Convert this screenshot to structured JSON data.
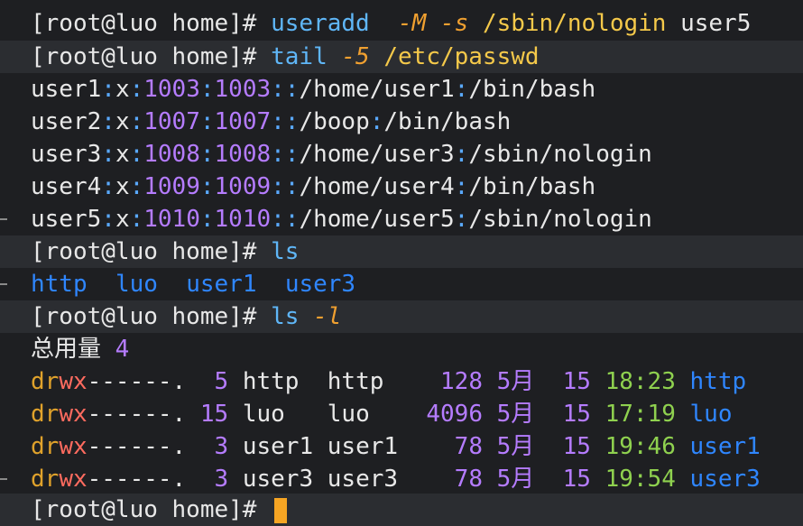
{
  "prompt": "[root@luo home]# ",
  "cmd1": {
    "name": "useradd",
    "opt": "-M -s",
    "arg1": "/sbin/nologin",
    "arg2": "user5"
  },
  "cmd2": {
    "name": "tail",
    "opt": "-5",
    "arg": "/etc/passwd"
  },
  "passwd": [
    {
      "user": "user1",
      "uid": "1003",
      "gid": "1003",
      "home": "/home/user1",
      "shell": "/bin/bash"
    },
    {
      "user": "user2",
      "uid": "1007",
      "gid": "1007",
      "home": "/boop",
      "shell": "/bin/bash"
    },
    {
      "user": "user3",
      "uid": "1008",
      "gid": "1008",
      "home": "/home/user3",
      "shell": "/sbin/nologin"
    },
    {
      "user": "user4",
      "uid": "1009",
      "gid": "1009",
      "home": "/home/user4",
      "shell": "/bin/bash"
    },
    {
      "user": "user5",
      "uid": "1010",
      "gid": "1010",
      "home": "/home/user5",
      "shell": "/sbin/nologin"
    }
  ],
  "cmd3": {
    "name": "ls"
  },
  "ls_out": [
    "http",
    "luo",
    "user1",
    "user3"
  ],
  "cmd4": {
    "name": "ls",
    "opt": "-l"
  },
  "total": {
    "label": "总用量",
    "value": "4"
  },
  "ll": [
    {
      "links": " 5",
      "owner": "http ",
      "group": "http ",
      "size": " 128",
      "month": "5月",
      "day": "15",
      "time": "18:23",
      "name": "http"
    },
    {
      "links": "15",
      "owner": "luo  ",
      "group": "luo  ",
      "size": "4096",
      "month": "5月",
      "day": "15",
      "time": "17:19",
      "name": "luo"
    },
    {
      "links": " 3",
      "owner": "user1",
      "group": "user1",
      "size": "  78",
      "month": "5月",
      "day": "15",
      "time": "19:46",
      "name": "user1"
    },
    {
      "links": " 3",
      "owner": "user3",
      "group": "user3",
      "size": "  78",
      "month": "5月",
      "day": "15",
      "time": "19:54",
      "name": "user3"
    }
  ],
  "perm": {
    "d": "dr",
    "w": "wx",
    "rest": "------."
  },
  "colors": {
    "bg": "#1e1f22",
    "cmd": "#5fb6f7",
    "opt": "#f0a030",
    "num": "#b57cff",
    "dir": "#2f86ff",
    "time": "#8fd14f",
    "cursor": "#f6a523"
  }
}
